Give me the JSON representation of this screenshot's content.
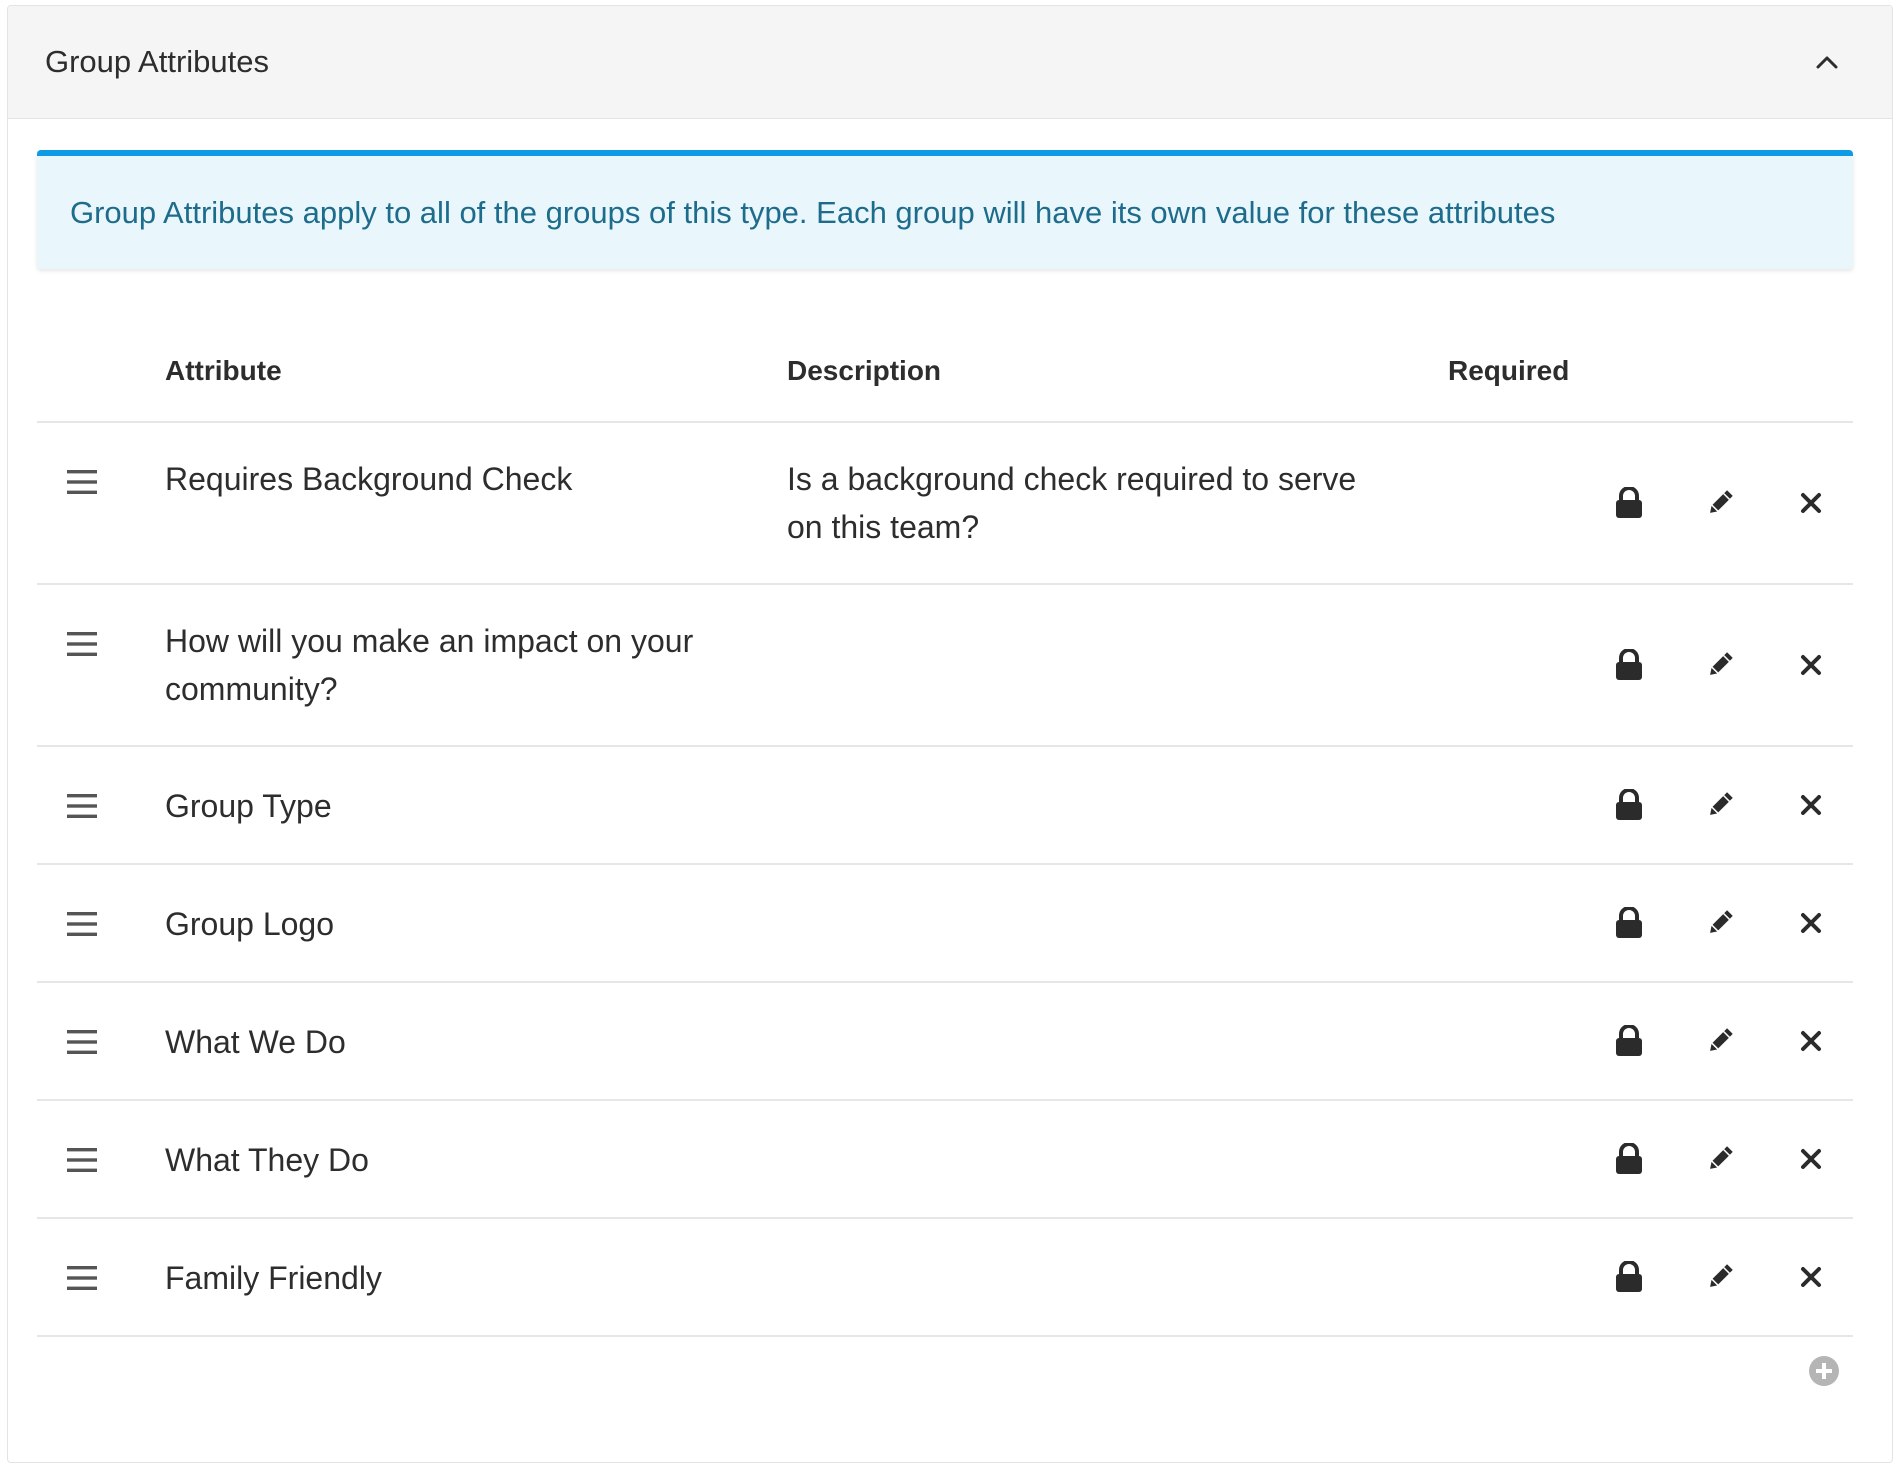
{
  "panel": {
    "title": "Group Attributes",
    "collapse_icon": "chevron-up-icon"
  },
  "alert": {
    "text": "Group Attributes apply to all of the groups of this type. Each group will have its own value for these attributes",
    "accent_color": "#0f9be3",
    "background_color": "#e9f7fd",
    "text_color": "#1e6c8c"
  },
  "table": {
    "headers": {
      "attribute": "Attribute",
      "description": "Description",
      "required": "Required"
    },
    "rows": [
      {
        "attribute": "Requires Background Check",
        "description": "Is a background check required to serve on this team?"
      },
      {
        "attribute": "How will you make an impact on your community?",
        "description": ""
      },
      {
        "attribute": "Group Type",
        "description": ""
      },
      {
        "attribute": "Group Logo",
        "description": ""
      },
      {
        "attribute": "What We Do",
        "description": ""
      },
      {
        "attribute": "What They Do",
        "description": ""
      },
      {
        "attribute": "Family Friendly",
        "description": ""
      }
    ],
    "row_icons": {
      "drag": "drag-handle-icon",
      "lock": "lock-icon",
      "edit": "pencil-icon",
      "delete": "close-icon"
    }
  },
  "add_button_icon": "plus-circle-icon"
}
